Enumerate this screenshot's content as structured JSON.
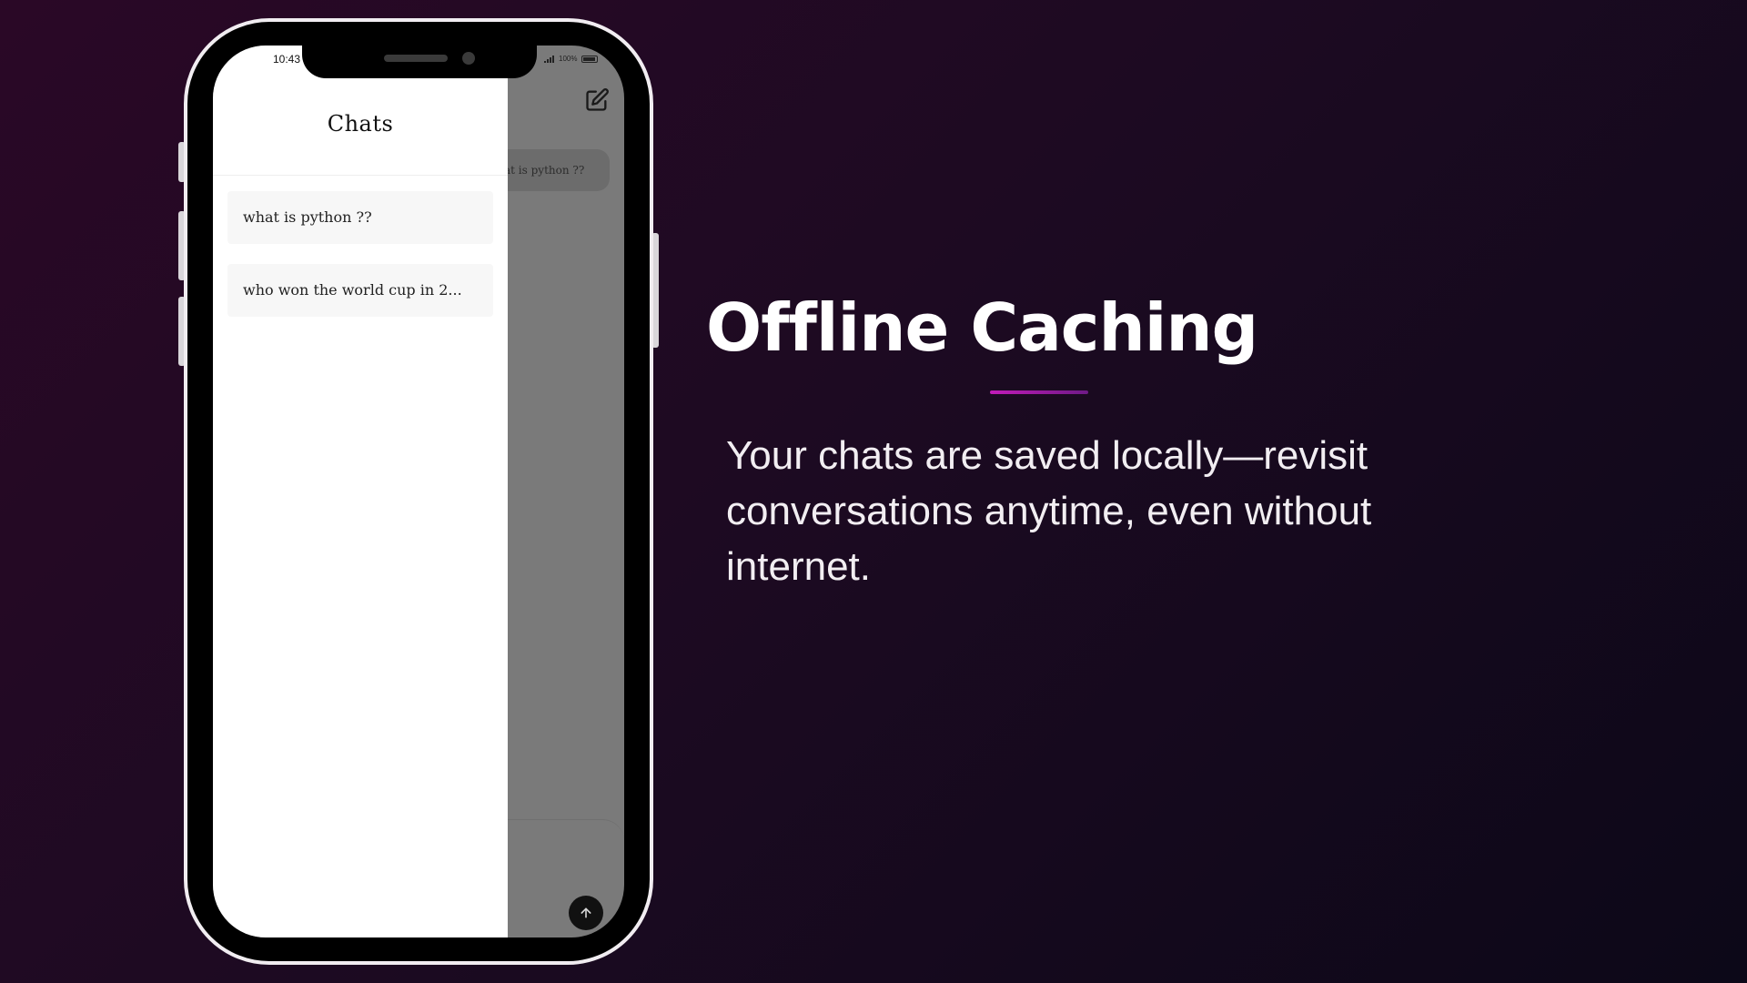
{
  "phone": {
    "status_bar": {
      "time": "10:43",
      "battery": "100%"
    },
    "drawer": {
      "title": "Chats",
      "items": [
        {
          "label": "what is python ??"
        },
        {
          "label": "who won the world cup in 2..."
        }
      ]
    },
    "background_chat": {
      "message": "what is python ??"
    }
  },
  "slide": {
    "headline": "Offline Caching",
    "description": "Your chats are saved locally—revisit conversations anytime, even without internet."
  },
  "colors": {
    "accent": "#c21bb8",
    "background": "#1d0a22"
  },
  "icons": [
    "edit-icon",
    "arrow-up-icon",
    "signal-icon",
    "battery-icon"
  ]
}
